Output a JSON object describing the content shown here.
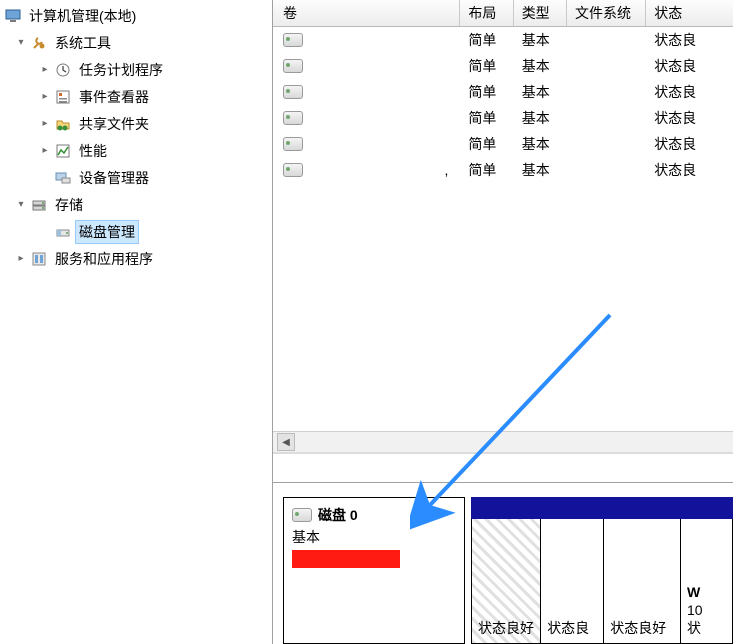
{
  "tree": {
    "root_label": "计算机管理(本地)",
    "items": [
      {
        "label": "系统工具",
        "icon": "tools"
      },
      {
        "label": "任务计划程序",
        "icon": "clock"
      },
      {
        "label": "事件查看器",
        "icon": "event"
      },
      {
        "label": "共享文件夹",
        "icon": "share"
      },
      {
        "label": "性能",
        "icon": "perf"
      },
      {
        "label": "设备管理器",
        "icon": "device"
      },
      {
        "label": "存储",
        "icon": "storage"
      },
      {
        "label": "磁盘管理",
        "icon": "diskmgr"
      },
      {
        "label": "服务和应用程序",
        "icon": "services"
      }
    ]
  },
  "columns": {
    "volume": "卷",
    "layout": "布局",
    "type": "类型",
    "fs": "文件系统",
    "status": "状态"
  },
  "rows": [
    {
      "layout": "简单",
      "type": "基本",
      "status": "状态良"
    },
    {
      "layout": "简单",
      "type": "基本",
      "status": "状态良"
    },
    {
      "layout": "简单",
      "type": "基本",
      "status": "状态良"
    },
    {
      "layout": "简单",
      "type": "基本",
      "status": "状态良"
    },
    {
      "layout": "简单",
      "type": "基本",
      "status": "状态良"
    },
    {
      "layout": "简单",
      "type": "基本",
      "status": "状态良"
    }
  ],
  "disk": {
    "title": "磁盘 0",
    "kind": "基本",
    "partitions": [
      {
        "status": "状态良好",
        "hatched": true
      },
      {
        "status": "状态良",
        "hatched": false
      },
      {
        "status": "状态良好",
        "hatched": false
      },
      {
        "status": "状",
        "hatched": false,
        "extraTop1": "W",
        "extraTop2": "10"
      }
    ]
  }
}
